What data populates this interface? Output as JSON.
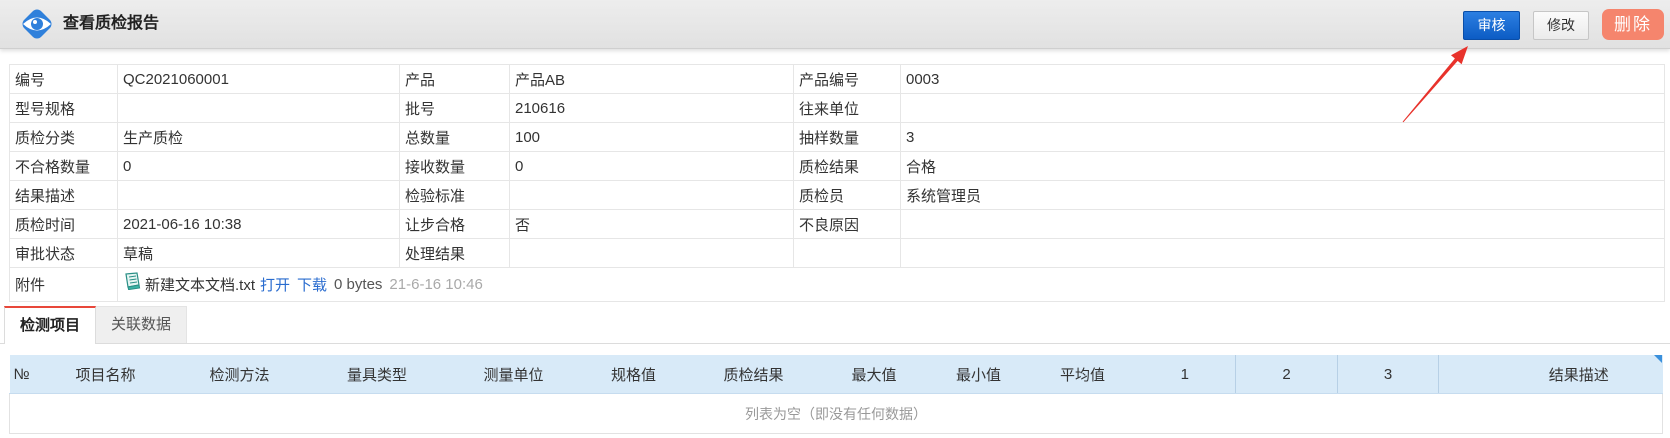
{
  "header": {
    "title": "查看质检报告",
    "buttons": {
      "approve": "审核",
      "edit": "修改",
      "delete": "删除"
    }
  },
  "icons": {
    "logo": "eye-icon",
    "attachment_file": "text-file-icon",
    "annotation": "red-arrow-icon"
  },
  "info": {
    "rows": [
      [
        {
          "label": "编号",
          "value": "QC2021060001"
        },
        {
          "label": "产品",
          "value": "产品AB"
        },
        {
          "label": "产品编号",
          "value": "0003"
        }
      ],
      [
        {
          "label": "型号规格",
          "value": ""
        },
        {
          "label": "批号",
          "value": "210616"
        },
        {
          "label": "往来单位",
          "value": ""
        }
      ],
      [
        {
          "label": "质检分类",
          "value": "生产质检"
        },
        {
          "label": "总数量",
          "value": "100"
        },
        {
          "label": "抽样数量",
          "value": "3"
        }
      ],
      [
        {
          "label": "不合格数量",
          "value": "0"
        },
        {
          "label": "接收数量",
          "value": "0"
        },
        {
          "label": "质检结果",
          "value": "合格"
        }
      ],
      [
        {
          "label": "结果描述",
          "value": ""
        },
        {
          "label": "检验标准",
          "value": ""
        },
        {
          "label": "质检员",
          "value": "系统管理员"
        }
      ],
      [
        {
          "label": "质检时间",
          "value": "2021-06-16 10:38"
        },
        {
          "label": "让步合格",
          "value": "否"
        },
        {
          "label": "不良原因",
          "value": ""
        }
      ],
      [
        {
          "label": "审批状态",
          "value": "草稿"
        },
        {
          "label": "处理结果",
          "value": ""
        },
        {
          "label": "",
          "value": ""
        }
      ]
    ],
    "attachment": {
      "label": "附件",
      "file_name": "新建文本文档.txt",
      "open_label": "打开",
      "download_label": "下载",
      "size": "0 bytes",
      "time": "21-6-16 10:46"
    }
  },
  "tabs": [
    {
      "label": "检测项目",
      "active": true
    },
    {
      "label": "关联数据",
      "active": false
    }
  ],
  "grid": {
    "columns": [
      "№",
      "项目名称",
      "检测方法",
      "量具类型",
      "测量单位",
      "规格值",
      "质检结果",
      "最大值",
      "最小值",
      "平均值",
      "1",
      "2",
      "3",
      "结果描述"
    ],
    "rows": [],
    "empty_text": "列表为空（即没有任何数据）"
  },
  "colors": {
    "approve_button": "#1466d3",
    "delete_button": "#f5856d",
    "annotation_arrow": "#e8322b",
    "active_tab_border": "#e8473a",
    "grid_header": "#d8eaf8",
    "link": "#2a6ccf"
  }
}
